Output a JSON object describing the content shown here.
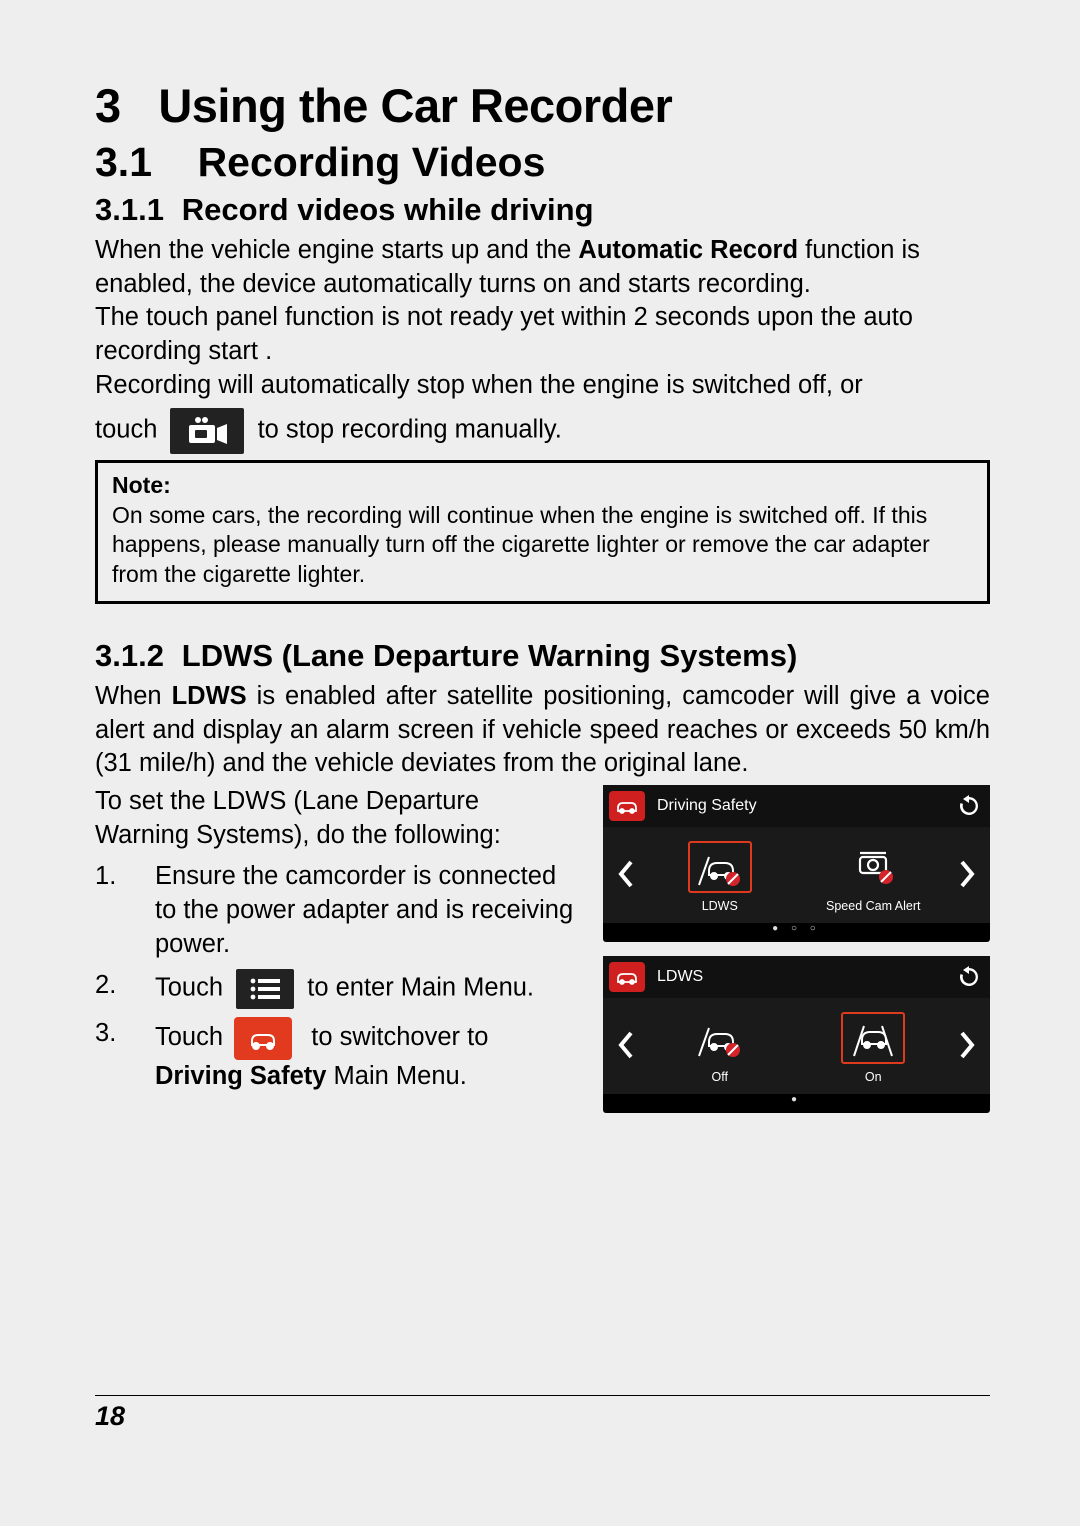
{
  "chapter": {
    "num": "3",
    "title": "Using the Car Recorder"
  },
  "section": {
    "num": "3.1",
    "title": "Recording Videos"
  },
  "sub1": {
    "num": "3.1.1",
    "title": "Record videos while driving",
    "para1a": "When the vehicle engine starts up and the ",
    "bold1": "Automatic Record",
    "para1b": " function is enabled, the device automatically turns on and starts recording.",
    "para2": "The touch panel function is not ready yet within 2 seconds upon the auto recording start .",
    "para3": "Recording will automatically stop when the engine is switched off, or",
    "touch_prefix": "touch ",
    "touch_suffix": " to stop recording manually.",
    "note_title": "Note:",
    "note_body": "On some cars, the recording will continue when the engine is switched off. If this happens, please manually turn off the cigarette lighter or remove the car adapter from the cigarette lighter."
  },
  "sub2": {
    "num": "3.1.2",
    "title": "LDWS (Lane Departure Warning Systems)",
    "para1a": "When ",
    "bold1": "LDWS",
    "para1b": " is enabled after satellite positioning, camcoder will give a voice alert and display an alarm screen if vehicle speed reaches or exceeds 50 km/h (31 mile/h) and the vehicle deviates from the original lane.",
    "para2": "To set the LDWS (Lane Departure Warning Systems), do the following:",
    "steps": {
      "s1": "Ensure the camcorder is connected to the power adapter and is receiving power.",
      "s2a": "Touch ",
      "s2b": " to enter Main Menu.",
      "s3a": "Touch ",
      "s3b": " to switchover to ",
      "s3bold": "Driving Safety",
      "s3c": " Main Menu."
    }
  },
  "panel1": {
    "title": "Driving Safety",
    "opts": {
      "a": "LDWS",
      "b": "Speed Cam Alert"
    }
  },
  "panel2": {
    "title": "LDWS",
    "opts": {
      "a": "Off",
      "b": "On"
    }
  },
  "page_number": "18"
}
